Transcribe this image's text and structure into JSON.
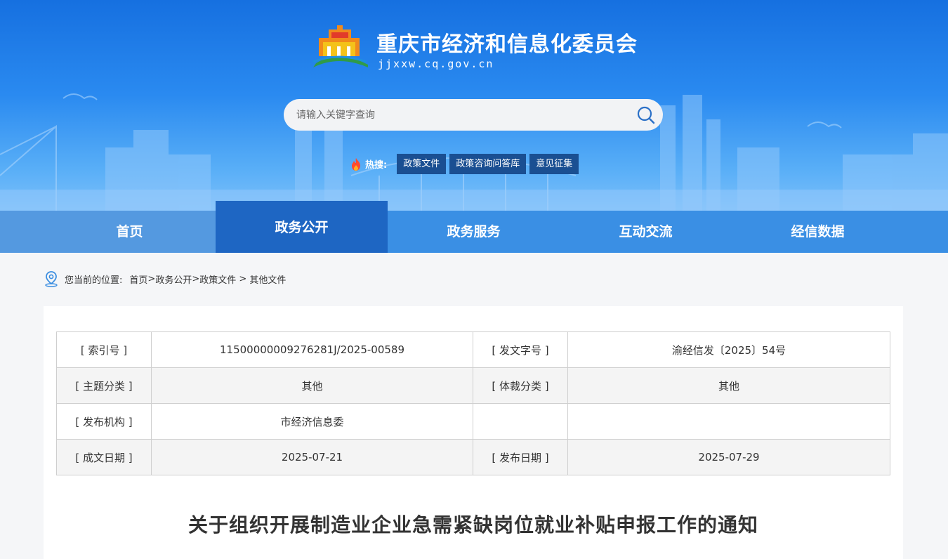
{
  "header": {
    "title": "重庆市经济和信息化委员会",
    "domain": "jjxxw.cq.gov.cn",
    "search_placeholder": "请输入关键字查询",
    "hot_label": "热搜:",
    "hot_tags": [
      "政策文件",
      "政策咨询问答库",
      "意见征集"
    ]
  },
  "nav": {
    "items": [
      "首页",
      "政务公开",
      "政务服务",
      "互动交流",
      "经信数据"
    ],
    "active": "政务公开"
  },
  "breadcrumb": {
    "prefix": "您当前的位置:",
    "links": [
      "首页",
      "政务公开",
      "政策文件",
      "其他文件"
    ],
    "separators": [
      ">",
      ">",
      " > "
    ]
  },
  "meta": {
    "rows": [
      [
        "[ 索引号 ]",
        "11500000009276281J/2025-00589",
        "[ 发文字号 ]",
        "渝经信发〔2025〕54号"
      ],
      [
        "[ 主题分类 ]",
        "其他",
        "[ 体裁分类 ]",
        "其他"
      ],
      [
        "[ 发布机构 ]",
        "市经济信息委",
        "",
        ""
      ],
      [
        "[ 成文日期 ]",
        "2025-07-21",
        "[ 发布日期 ]",
        "2025-07-29"
      ]
    ]
  },
  "document": {
    "title": "关于组织开展制造业企业急需紧缺岗位就业补贴申报工作的通知"
  },
  "colors": {
    "nav_bar": "#3a8fe4",
    "nav_active": "#1e66c3",
    "hot_tag": "#1a4f92"
  }
}
